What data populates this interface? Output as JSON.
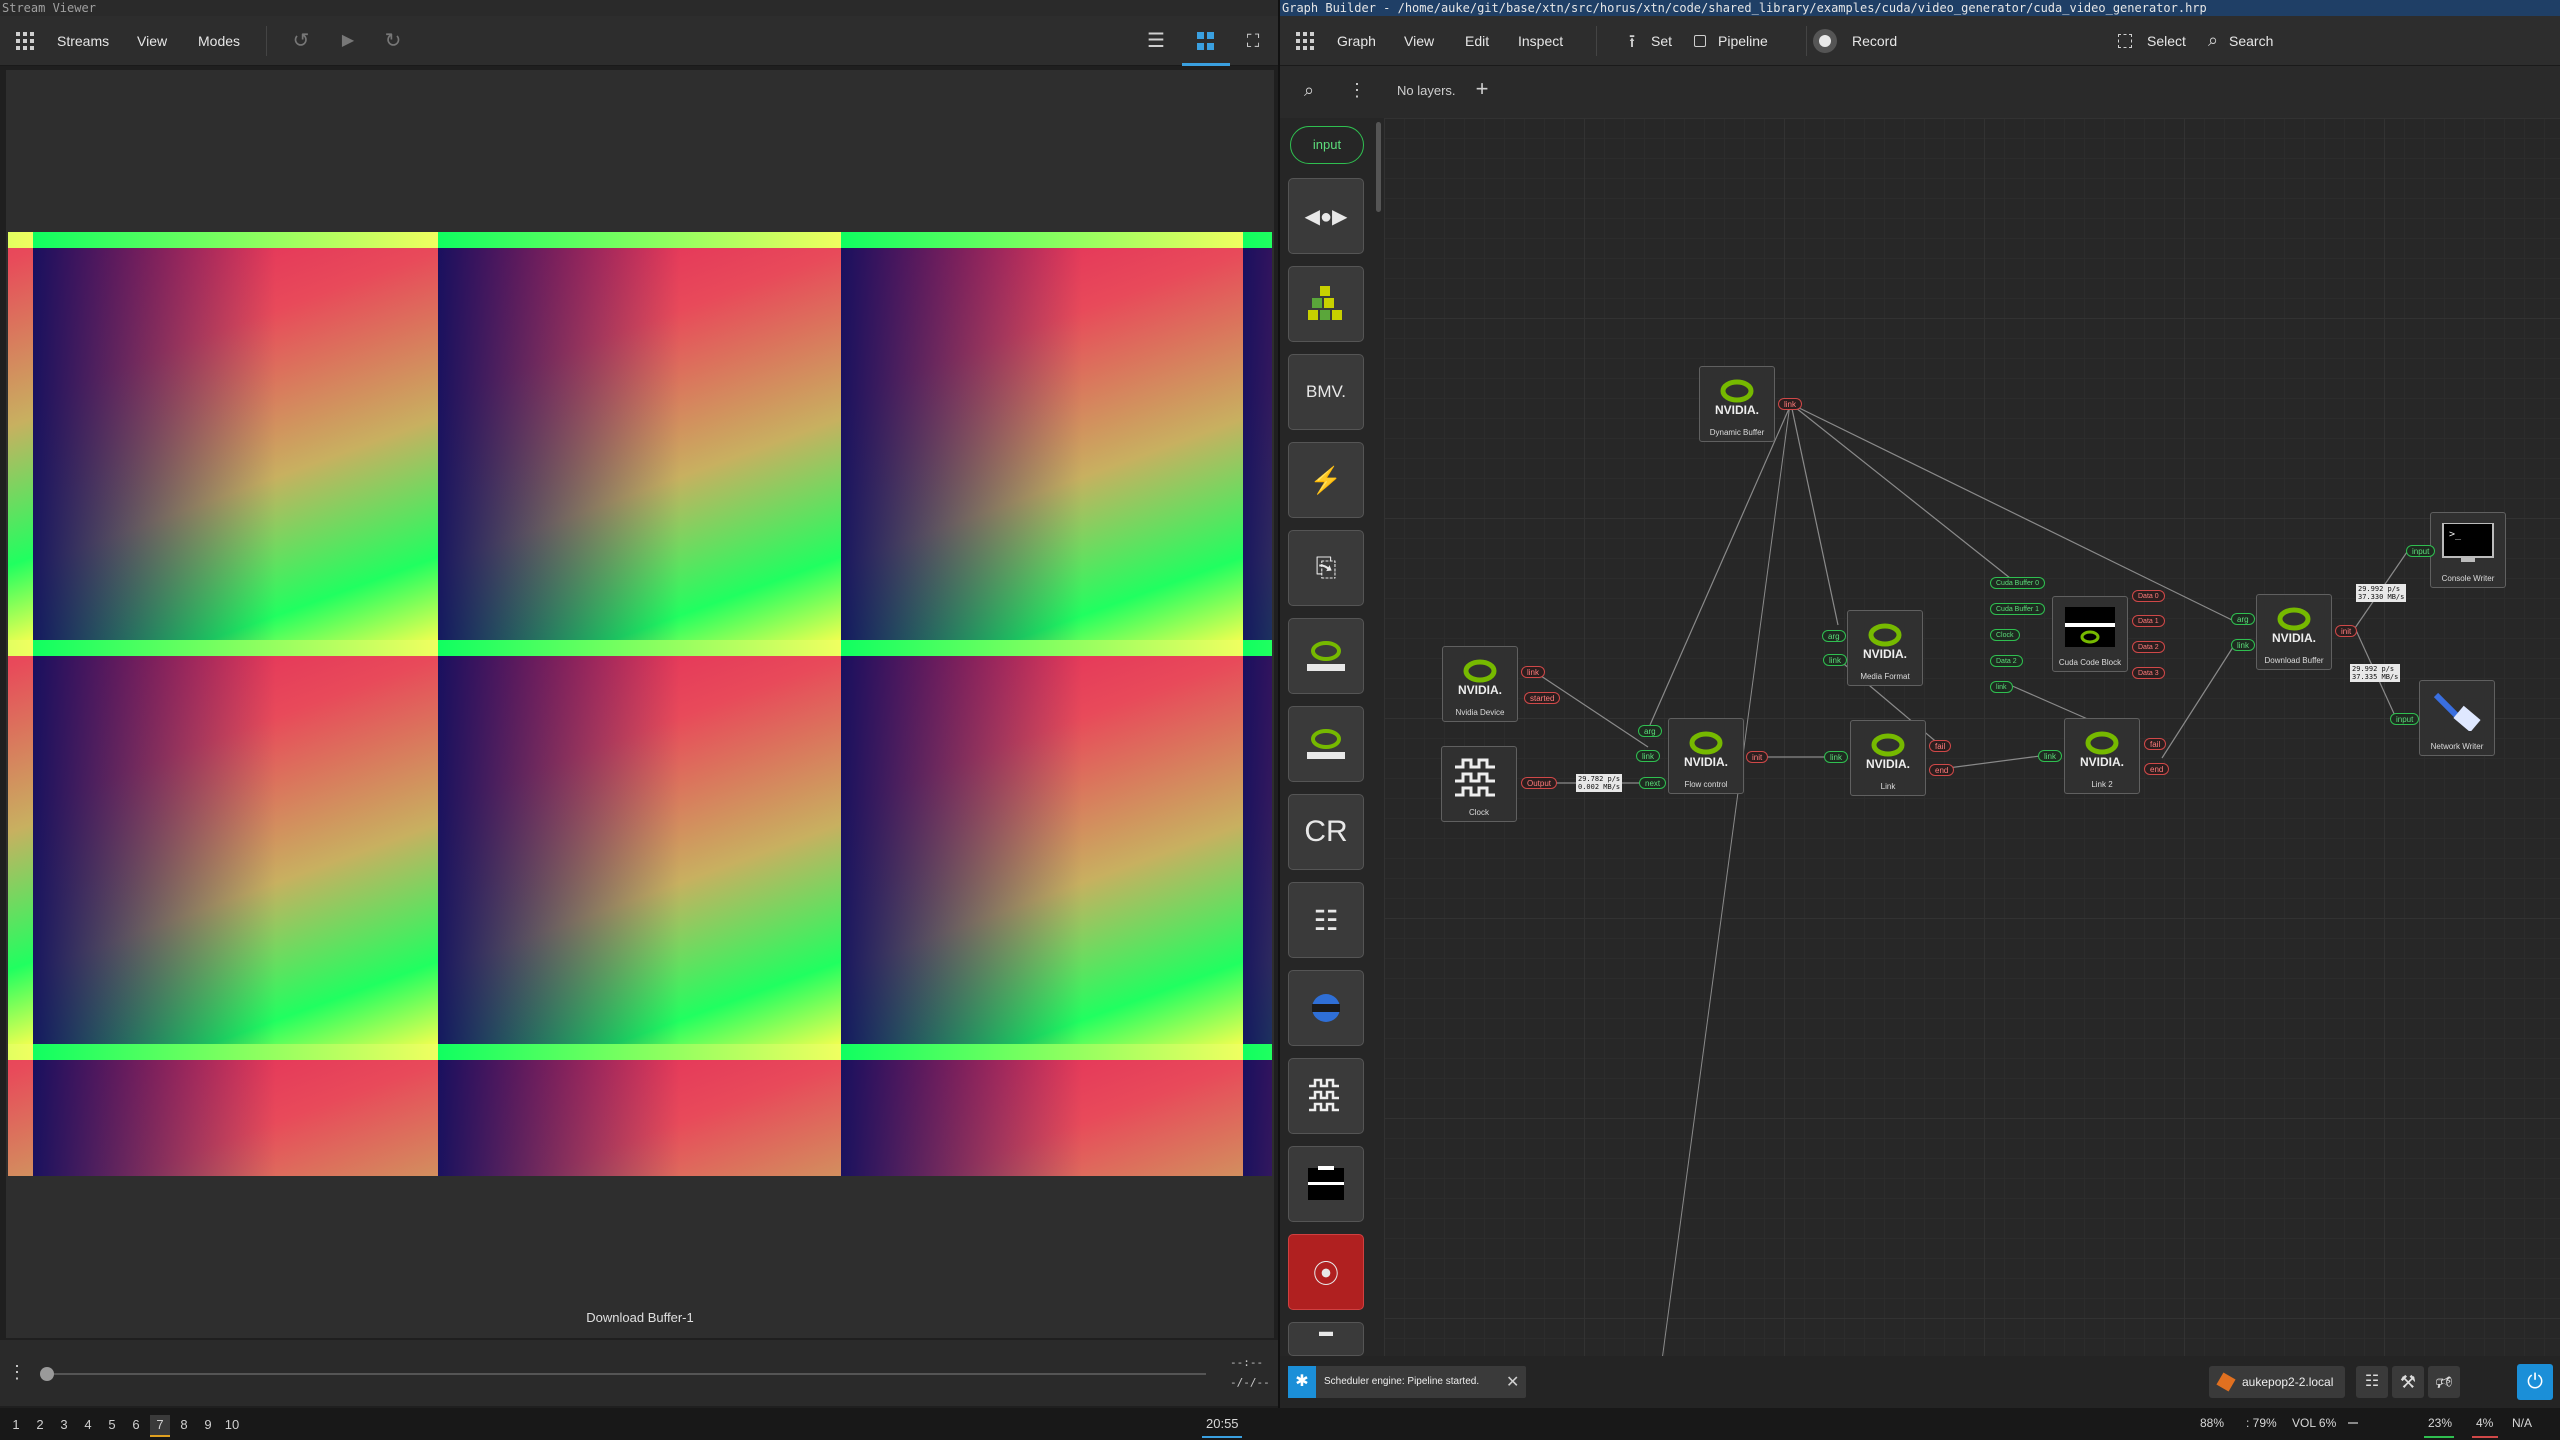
{
  "left": {
    "window_title": "Stream Viewer",
    "menu": [
      "Streams",
      "View",
      "Modes"
    ],
    "stream_label": "Download Buffer-1",
    "time_top": "--:--",
    "time_bottom": "-/-/--",
    "icons": {
      "apps": "apps-grid-icon",
      "undo": "undo-icon",
      "play": "play-icon",
      "redo": "redo-icon",
      "list": "list-view-icon",
      "tiles": "tile-view-icon",
      "fullscreen": "fullscreen-icon"
    }
  },
  "right": {
    "window_title": "Graph Builder - /home/auke/git/base/xtn/src/horus/xtn/code/shared_library/examples/cuda/video_generator/cuda_video_generator.hrp",
    "menu": [
      "Graph",
      "View",
      "Edit",
      "Inspect"
    ],
    "set_label": "Set",
    "pipeline_label": "Pipeline",
    "record_label": "Record",
    "select_label": "Select",
    "search_label": "Search",
    "layers_text": "No layers.",
    "palette_input_label": "input",
    "palette_bmv": "BMV.",
    "palette_cr": "CR",
    "nodes": {
      "dynamic_buffer": "Dynamic Buffer",
      "nvidia_device": "Nvidia Device",
      "clock": "Clock",
      "flow_control": "Flow control",
      "media_format": "Media Format",
      "link": "Link",
      "cuda_code_block": "Cuda Code Block",
      "link2": "Link 2",
      "download_buffer": "Download Buffer",
      "console_writer": "Console Writer",
      "network_writer": "Network Writer"
    },
    "ports": {
      "link": "link",
      "started": "started",
      "output": "Output",
      "arg": "arg",
      "next": "next",
      "init": "init",
      "fail": "fail",
      "end": "end",
      "input": "input",
      "cb0": "Cuda Buffer 0",
      "cb1": "Cuda Buffer 1",
      "clock": "Clock",
      "data2": "Data 2",
      "data0": "Data 0",
      "data1": "Data 1",
      "data2b": "Data 2",
      "data3": "Data 3"
    },
    "rates": {
      "clock_flow": "29.782 p/s\n0.002 MB/s",
      "download_console": "29.992 p/s\n37.330 MB/s",
      "download_network": "29.992 p/s\n37.335 MB/s"
    },
    "notification": "Scheduler engine: Pipeline started.",
    "host": "aukepop2-2.local"
  },
  "statusbar": {
    "workspaces": [
      "1",
      "2",
      "3",
      "4",
      "5",
      "6",
      "7",
      "8",
      "9",
      "10"
    ],
    "active_workspace": "7",
    "clock": "20:55",
    "battery": "88%",
    "brightness": ": 79%",
    "volume": "VOL 6%",
    "cpu": "23%",
    "mem": "4%",
    "net": "N/A"
  }
}
